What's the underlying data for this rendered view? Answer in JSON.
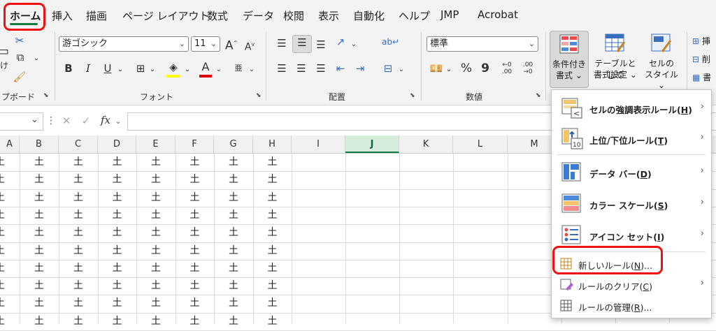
{
  "tabs": [
    "ホーム",
    "挿入",
    "描画",
    "ページ レイアウト",
    "数式",
    "データ",
    "校閲",
    "表示",
    "自動化",
    "ヘルプ",
    "JMP",
    "Acrobat"
  ],
  "ribbon": {
    "clipboard": {
      "paste_label": "け",
      "group_label": "プボード"
    },
    "font": {
      "font_name": "游ゴシック",
      "font_size": "11",
      "group_label": "フォント",
      "bold": "B",
      "italic": "I",
      "underline": "U",
      "font_color_letter": "A",
      "grow": "A",
      "shrink": "A"
    },
    "alignment": {
      "group_label": "配置"
    },
    "number": {
      "format": "標準",
      "group_label": "数値",
      "percent": "%",
      "comma": "9",
      "inc_decimal": ".00",
      "dec_decimal": ".00"
    },
    "styles": {
      "conditional_line1": "条件付き",
      "conditional_line2": "書式",
      "table_line1": "テーブルとして",
      "table_line2": "書式設定",
      "cell_line1": "セルの",
      "cell_line2": "スタイル"
    },
    "cells": {
      "insert": "挿",
      "delete": "削",
      "format": "書"
    }
  },
  "formula_bar": {
    "fx": "fx",
    "value": ""
  },
  "columns": [
    "A",
    "B",
    "C",
    "D",
    "E",
    "F",
    "G",
    "H",
    "I",
    "J",
    "K",
    "L",
    "M"
  ],
  "selected_column": "J",
  "cell_value": "土",
  "menu": {
    "items": [
      {
        "label": "セルの強調表示ルール",
        "key": "H"
      },
      {
        "label": "上位/下位ルール",
        "key": "T"
      },
      {
        "label": "データ バー",
        "key": "D"
      },
      {
        "label": "カラー スケール",
        "key": "S"
      },
      {
        "label": "アイコン セット",
        "key": "I"
      }
    ],
    "new_rule": {
      "label": "新しいルール",
      "key": "N",
      "suffix": "..."
    },
    "clear_rules": {
      "label": "ルールのクリア",
      "key": "C",
      "suffix": ""
    },
    "manage_rules": {
      "label": "ルールの管理",
      "key": "R",
      "suffix": "..."
    },
    "icon_10": "10"
  },
  "colors": {
    "excel_green": "#107c41",
    "highlight_red": "#e11111"
  }
}
